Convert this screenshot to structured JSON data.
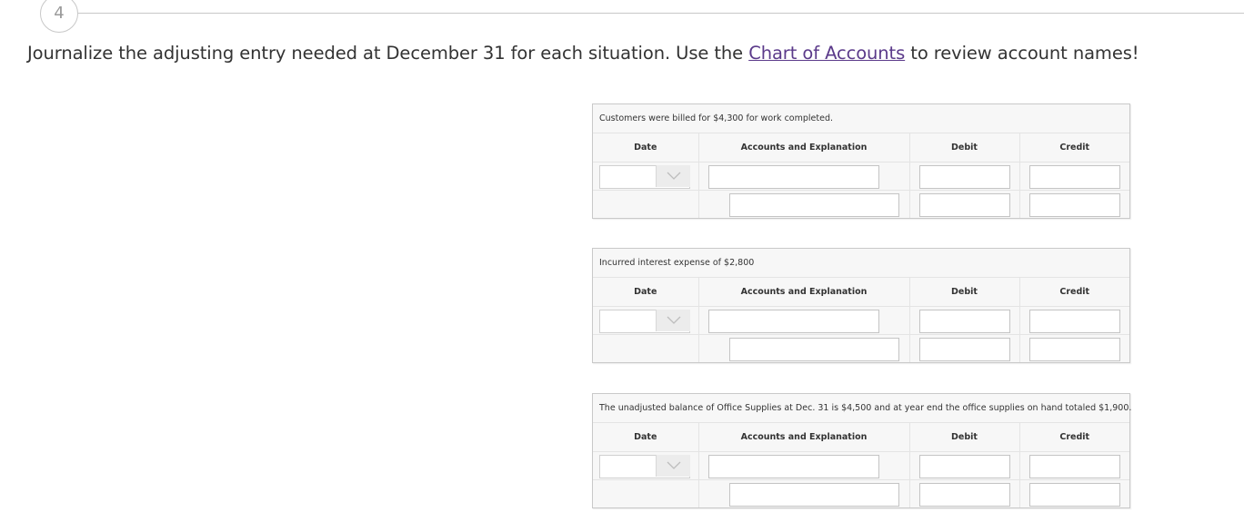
{
  "step": {
    "number": "4"
  },
  "instructions": {
    "before_link": "Journalize the adjusting entry needed at December 31 for each situation. Use the ",
    "link_text": "Chart of Accounts",
    "after_link": " to review account names!"
  },
  "columns": {
    "date": "Date",
    "accounts": "Accounts and Explanation",
    "debit": "Debit",
    "credit": "Credit"
  },
  "entries": [
    {
      "prompt": "Customers were billed for $4,300 for work completed.",
      "date_value": "",
      "rows": [
        {
          "account": "",
          "debit": "",
          "credit": ""
        },
        {
          "account": "",
          "debit": "",
          "credit": ""
        }
      ]
    },
    {
      "prompt": "Incurred interest expense of $2,800",
      "date_value": "",
      "rows": [
        {
          "account": "",
          "debit": "",
          "credit": ""
        },
        {
          "account": "",
          "debit": "",
          "credit": ""
        }
      ]
    },
    {
      "prompt": "The unadjusted balance of Office Supplies at Dec. 31 is $4,500 and at year end the office supplies on hand totaled $1,900.",
      "date_value": "",
      "rows": [
        {
          "account": "",
          "debit": "",
          "credit": ""
        },
        {
          "account": "",
          "debit": "",
          "credit": ""
        }
      ]
    }
  ],
  "icons": {
    "date_dropdown": "chevron-down-icon"
  },
  "colors": {
    "link": "#5b3a8a",
    "panel_bg": "#f7f7f7",
    "border": "#c9c9c9"
  }
}
